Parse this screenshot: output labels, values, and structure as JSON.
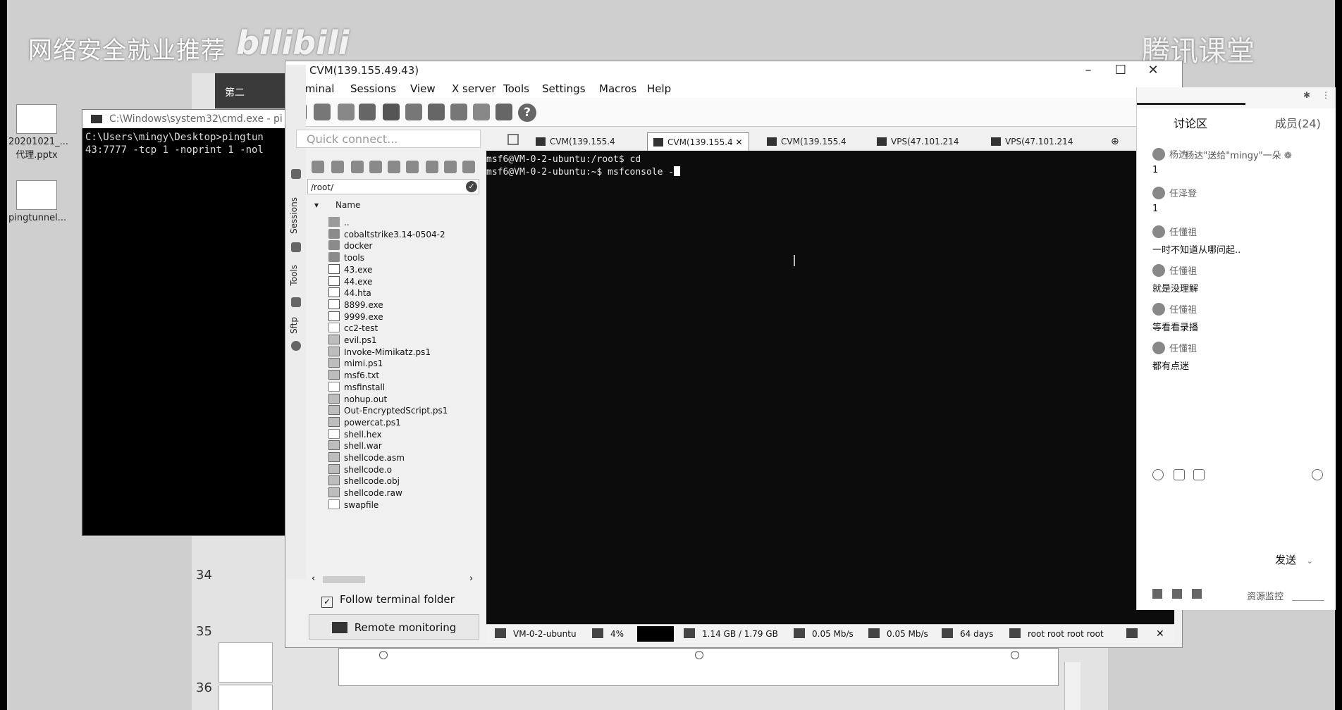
{
  "watermarks": {
    "left": "网络安全就业推荐",
    "bili": "bilibili",
    "right": "腾讯课堂"
  },
  "desktop_icons": [
    {
      "label": "20201021_...\n代理.pptx"
    },
    {
      "label": "pingtunnel..."
    }
  ],
  "ppt": {
    "top_label": "第二",
    "slide_numbers": [
      "34",
      "35",
      "36"
    ]
  },
  "cmd": {
    "title": "C:\\Windows\\system32\\cmd.exe - pi",
    "lines": [
      "C:\\Users\\mingy\\Desktop>pingtun",
      "43:7777 -tcp 1 -noprint 1 -nol"
    ]
  },
  "moba": {
    "title": "CVM(139.155.49.43)",
    "menu": [
      "Terminal",
      "Sessions",
      "View",
      "X server",
      "Tools",
      "Settings",
      "Macros",
      "Help"
    ],
    "quick_connect_placeholder": "Quick connect...",
    "vertical_tabs": [
      "Sessions",
      "Tools",
      "Sftp"
    ],
    "sftp_path": "/root/",
    "column_header": "Name",
    "files": [
      {
        "name": "..",
        "kind": "up"
      },
      {
        "name": "cobaltstrike3.14-0504-2",
        "kind": "folder"
      },
      {
        "name": "docker",
        "kind": "folder"
      },
      {
        "name": "tools",
        "kind": "folder"
      },
      {
        "name": "43.exe",
        "kind": "exe"
      },
      {
        "name": "44.exe",
        "kind": "exe"
      },
      {
        "name": "44.hta",
        "kind": "exe"
      },
      {
        "name": "8899.exe",
        "kind": "exe"
      },
      {
        "name": "9999.exe",
        "kind": "exe"
      },
      {
        "name": "cc2-test",
        "kind": "doc"
      },
      {
        "name": "evil.ps1",
        "kind": "scr"
      },
      {
        "name": "Invoke-Mimikatz.ps1",
        "kind": "scr"
      },
      {
        "name": "mimi.ps1",
        "kind": "scr"
      },
      {
        "name": "msf6.txt",
        "kind": "scr"
      },
      {
        "name": "msfinstall",
        "kind": "doc"
      },
      {
        "name": "nohup.out",
        "kind": "scr"
      },
      {
        "name": "Out-EncryptedScript.ps1",
        "kind": "scr"
      },
      {
        "name": "powercat.ps1",
        "kind": "scr"
      },
      {
        "name": "shell.hex",
        "kind": "doc"
      },
      {
        "name": "shell.war",
        "kind": "scr"
      },
      {
        "name": "shellcode.asm",
        "kind": "scr"
      },
      {
        "name": "shellcode.o",
        "kind": "scr"
      },
      {
        "name": "shellcode.obj",
        "kind": "scr"
      },
      {
        "name": "shellcode.raw",
        "kind": "scr"
      },
      {
        "name": "swapfile",
        "kind": "doc"
      }
    ],
    "follow_terminal_label": "Follow terminal folder",
    "follow_terminal_checked": true,
    "remote_monitoring_label": "Remote monitoring",
    "tabs": [
      {
        "label": "CVM(139.155.4",
        "active": false
      },
      {
        "label": "CVM(139.155.4",
        "active": true
      },
      {
        "label": "CVM(139.155.4",
        "active": false
      },
      {
        "label": "VPS(47.101.214",
        "active": false
      },
      {
        "label": "VPS(47.101.214",
        "active": false
      }
    ],
    "terminal_lines": [
      "msf6@VM-0-2-ubuntu:/root$ cd",
      "msf6@VM-0-2-ubuntu:~$ msfconsole -"
    ],
    "status": {
      "host": "VM-0-2-ubuntu",
      "cpu": "4%",
      "memory": "1.14 GB / 1.79 GB",
      "upload": "0.05 Mb/s",
      "download": "0.05 Mb/s",
      "uptime": "64 days",
      "users": "root root root root"
    }
  },
  "chat": {
    "title": "讨论区",
    "members": "成员(24)",
    "gift": "\"杨达\"送给\"mingy\"一朵",
    "messages": [
      {
        "user": "杨达",
        "text": "1"
      },
      {
        "user": "任泽登",
        "text": "1"
      },
      {
        "user": "任懂祖",
        "text": "一时不知道从哪问起.."
      },
      {
        "user": "任懂祖",
        "text": "就是没理解"
      },
      {
        "user": "任懂祖",
        "text": "等看看录播"
      },
      {
        "user": "任懂祖",
        "text": "都有点迷"
      }
    ],
    "send_label": "发送",
    "resource_label": "资源监控"
  }
}
